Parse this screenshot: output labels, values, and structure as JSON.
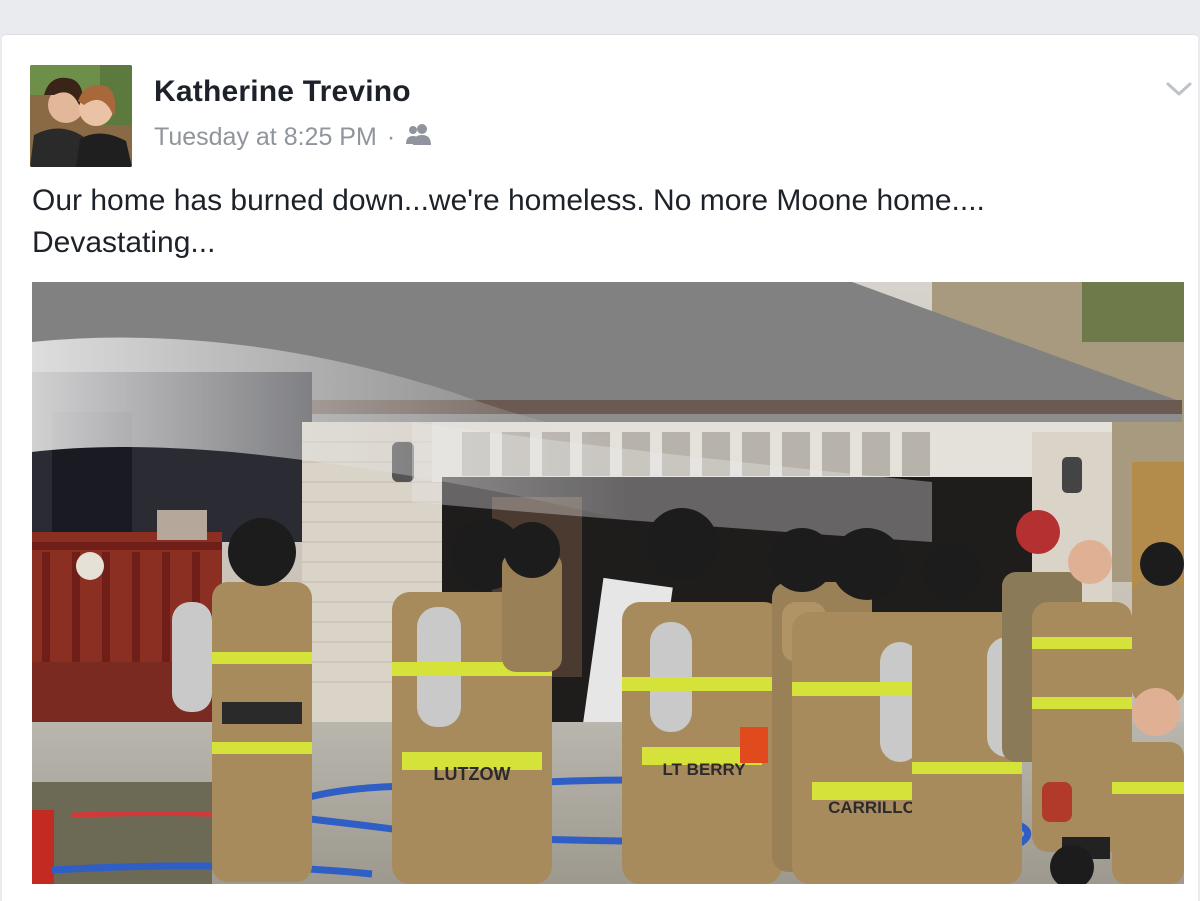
{
  "post": {
    "author_name": "Katherine Trevino",
    "timestamp": "Tuesday at 8:25 PM",
    "separator": "·",
    "audience_icon": "friends-icon",
    "menu_icon": "chevron-down-icon",
    "text": "Our home has burned down...we're homeless. No more Moone home.... Devastating..."
  },
  "photo": {
    "name_tags": [
      "LUTZOW",
      "LT BERRY",
      "CARRILLO"
    ]
  },
  "colors": {
    "author": "#1d2129",
    "meta": "#90949c",
    "turnout_gear": "#a88b5c",
    "reflective_stripe": "#d4e23a",
    "hose": "#2f5fc4"
  }
}
